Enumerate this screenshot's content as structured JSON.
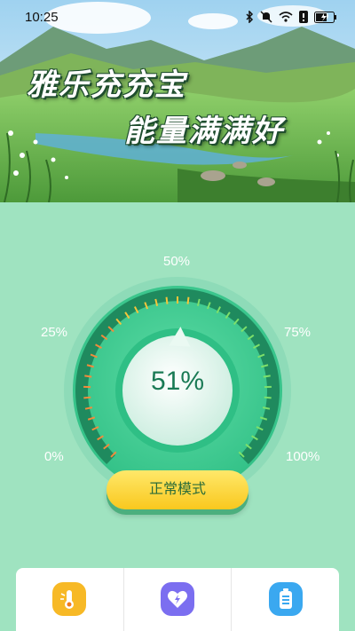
{
  "status_bar": {
    "time": "10:25",
    "icons": [
      "bluetooth-icon",
      "mute-icon",
      "wifi-icon",
      "alert-icon",
      "battery-charging-icon"
    ]
  },
  "banner": {
    "headline_line1": "雅乐充充宝",
    "headline_line2": "能量满满好"
  },
  "gauge": {
    "labels": {
      "p0": "0%",
      "p25": "25%",
      "p50": "50%",
      "p75": "75%",
      "p100": "100%"
    },
    "value_text": "51%",
    "level": 0.51
  },
  "mode_button": {
    "label": "正常模式"
  },
  "bottom_tools": [
    {
      "icon": "temperature-icon"
    },
    {
      "icon": "heart-bolt-icon"
    },
    {
      "icon": "battery-icon"
    }
  ],
  "colors": {
    "background": "#9fe3c0",
    "ring": "#3fcf94",
    "accent_yellow": "#f9c81e",
    "text_green": "#1a7a55"
  }
}
